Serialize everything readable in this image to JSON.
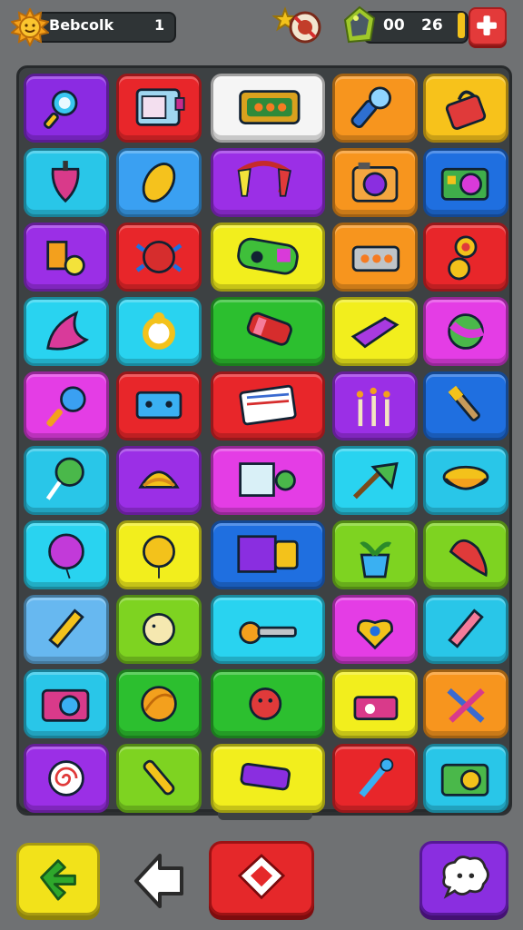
{
  "hud": {
    "player_name": "Bebcolk",
    "level": "1",
    "score_left": "00",
    "score_right": "26",
    "icons": [
      "sun-icon",
      "star-locked-icon",
      "gem-icon",
      "plus-icon"
    ]
  },
  "board": {
    "rows": [
      [
        {
          "icon": "magnifier",
          "color": "#8b2be2"
        },
        {
          "icon": "window",
          "color": "#e8262a"
        },
        {
          "icon": "radio",
          "color": "#f5f5f5",
          "wide": true
        },
        {
          "icon": "microphone",
          "color": "#f7951e"
        },
        {
          "icon": "bag",
          "color": "#f7c21b"
        }
      ],
      [
        {
          "icon": "spinning-top",
          "color": "#29c6e8"
        },
        {
          "icon": "lemon",
          "color": "#3aa0f2"
        },
        {
          "icon": "magnet",
          "color": "#9b2fe6",
          "wide": true
        },
        {
          "icon": "camera",
          "color": "#f7951e"
        },
        {
          "icon": "camera-retro",
          "color": "#1f6fe0"
        }
      ],
      [
        {
          "icon": "blocks",
          "color": "#9b2fe6"
        },
        {
          "icon": "bug",
          "color": "#e8262a"
        },
        {
          "icon": "gamepad",
          "color": "#f2ee1d",
          "wide": true
        },
        {
          "icon": "projector",
          "color": "#f7951e"
        },
        {
          "icon": "fidget-spinner",
          "color": "#e8262a"
        }
      ],
      [
        {
          "icon": "feather",
          "color": "#29d3f0"
        },
        {
          "icon": "ring",
          "color": "#29d3f0"
        },
        {
          "icon": "candy",
          "color": "#2cbf2f",
          "wide": true
        },
        {
          "icon": "eraser",
          "color": "#f2ee1d"
        },
        {
          "icon": "ball",
          "color": "#e43de5"
        }
      ],
      [
        {
          "icon": "ice-cream",
          "color": "#e43de5"
        },
        {
          "icon": "robot",
          "color": "#e8262a"
        },
        {
          "icon": "book",
          "color": "#e8262a",
          "wide": true
        },
        {
          "icon": "candles",
          "color": "#9b2fe6"
        },
        {
          "icon": "brush",
          "color": "#1f6fe0"
        }
      ],
      [
        {
          "icon": "lollipop",
          "color": "#29c6e8"
        },
        {
          "icon": "taco",
          "color": "#9b2fe6"
        },
        {
          "icon": "frame",
          "color": "#e43de5",
          "wide": true
        },
        {
          "icon": "broom",
          "color": "#29d3f0"
        },
        {
          "icon": "bowl",
          "color": "#29c6e8"
        }
      ],
      [
        {
          "icon": "balloon",
          "color": "#29d3f0"
        },
        {
          "icon": "balloon-small",
          "color": "#f2ee1d"
        },
        {
          "icon": "console",
          "color": "#1f6fe0",
          "wide": true
        },
        {
          "icon": "plant",
          "color": "#7ed321"
        },
        {
          "icon": "pepper",
          "color": "#7ed321"
        }
      ],
      [
        {
          "icon": "pencil",
          "color": "#67b8f0"
        },
        {
          "icon": "hedgehog",
          "color": "#7ed321"
        },
        {
          "icon": "key",
          "color": "#29d3f0",
          "wide": true
        },
        {
          "icon": "heart-lock",
          "color": "#e43de5"
        },
        {
          "icon": "crayon",
          "color": "#29c6e8"
        }
      ],
      [
        {
          "icon": "camera-pink",
          "color": "#29c6e8"
        },
        {
          "icon": "orange",
          "color": "#2cbf2f"
        },
        {
          "icon": "flower",
          "color": "#2cbf2f",
          "wide": true
        },
        {
          "icon": "tape",
          "color": "#f2ee1d"
        },
        {
          "icon": "tools",
          "color": "#f7951e"
        }
      ],
      [
        {
          "icon": "spiral",
          "color": "#9b2fe6"
        },
        {
          "icon": "rocket",
          "color": "#7ed321"
        },
        {
          "icon": "toy-gun",
          "color": "#f2ee1d",
          "wide": true
        },
        {
          "icon": "wrench",
          "color": "#e8262a"
        },
        {
          "icon": "camera-green",
          "color": "#29c6e8"
        }
      ]
    ]
  },
  "controls": {
    "back": "back-arrow-icon",
    "move": "direction-arrow-icon",
    "stop": "stop-icon",
    "chat": "chat-bubble-icon"
  }
}
